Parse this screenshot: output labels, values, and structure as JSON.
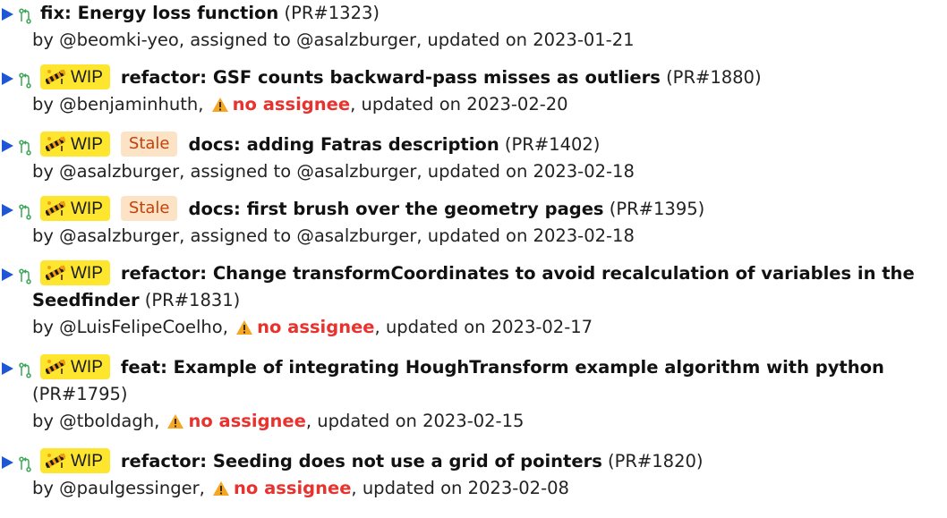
{
  "labels": {
    "by": "by",
    "assigned_to": "assigned to",
    "updated_on": "updated on",
    "no_assignee": "no assignee",
    "wip": "WIP",
    "stale": "Stale"
  },
  "colors": {
    "toggle_arrow": "#1f56d6",
    "pr_icon": "#3aa655",
    "wip_badge": "#ffe62e",
    "stale_badge_bg": "#fde3c5",
    "stale_badge_text": "#c2410c",
    "no_assignee": "#e8322e",
    "warning": "#f5a623"
  },
  "icons": {
    "toggle": "triangle-right-icon",
    "pr": "git-pull-request-icon",
    "wip": "construction-barrier-icon",
    "warning": "warning-triangle-icon"
  },
  "pull_requests": [
    {
      "title": "fix: Energy loss function",
      "number": "(PR#1323)",
      "author": "@beomki-yeo",
      "assignee": "@asalzburger",
      "updated": "2023-01-21",
      "wip": false,
      "stale": false
    },
    {
      "title": "refactor: GSF counts backward-pass misses as outliers",
      "number": "(PR#1880)",
      "author": "@benjaminhuth",
      "assignee": null,
      "updated": "2023-02-20",
      "wip": true,
      "stale": false
    },
    {
      "title": "docs: adding Fatras description",
      "number": "(PR#1402)",
      "author": "@asalzburger",
      "assignee": "@asalzburger",
      "updated": "2023-02-18",
      "wip": true,
      "stale": true
    },
    {
      "title": "docs: first brush over the geometry pages",
      "number": "(PR#1395)",
      "author": "@asalzburger",
      "assignee": "@asalzburger",
      "updated": "2023-02-18",
      "wip": true,
      "stale": true
    },
    {
      "title": "refactor: Change transformCoordinates to avoid recalculation of variables in the Seedfinder",
      "number": "(PR#1831)",
      "author": "@LuisFelipeCoelho",
      "assignee": null,
      "updated": "2023-02-17",
      "wip": true,
      "stale": false
    },
    {
      "title": "feat: Example of integrating HoughTransform example algorithm with python",
      "number": "(PR#1795)",
      "author": "@tboldagh",
      "assignee": null,
      "updated": "2023-02-15",
      "wip": true,
      "stale": false
    },
    {
      "title": "refactor: Seeding does not use a grid of pointers",
      "number": "(PR#1820)",
      "author": "@paulgessinger",
      "assignee": null,
      "updated": "2023-02-08",
      "wip": true,
      "stale": false
    }
  ]
}
